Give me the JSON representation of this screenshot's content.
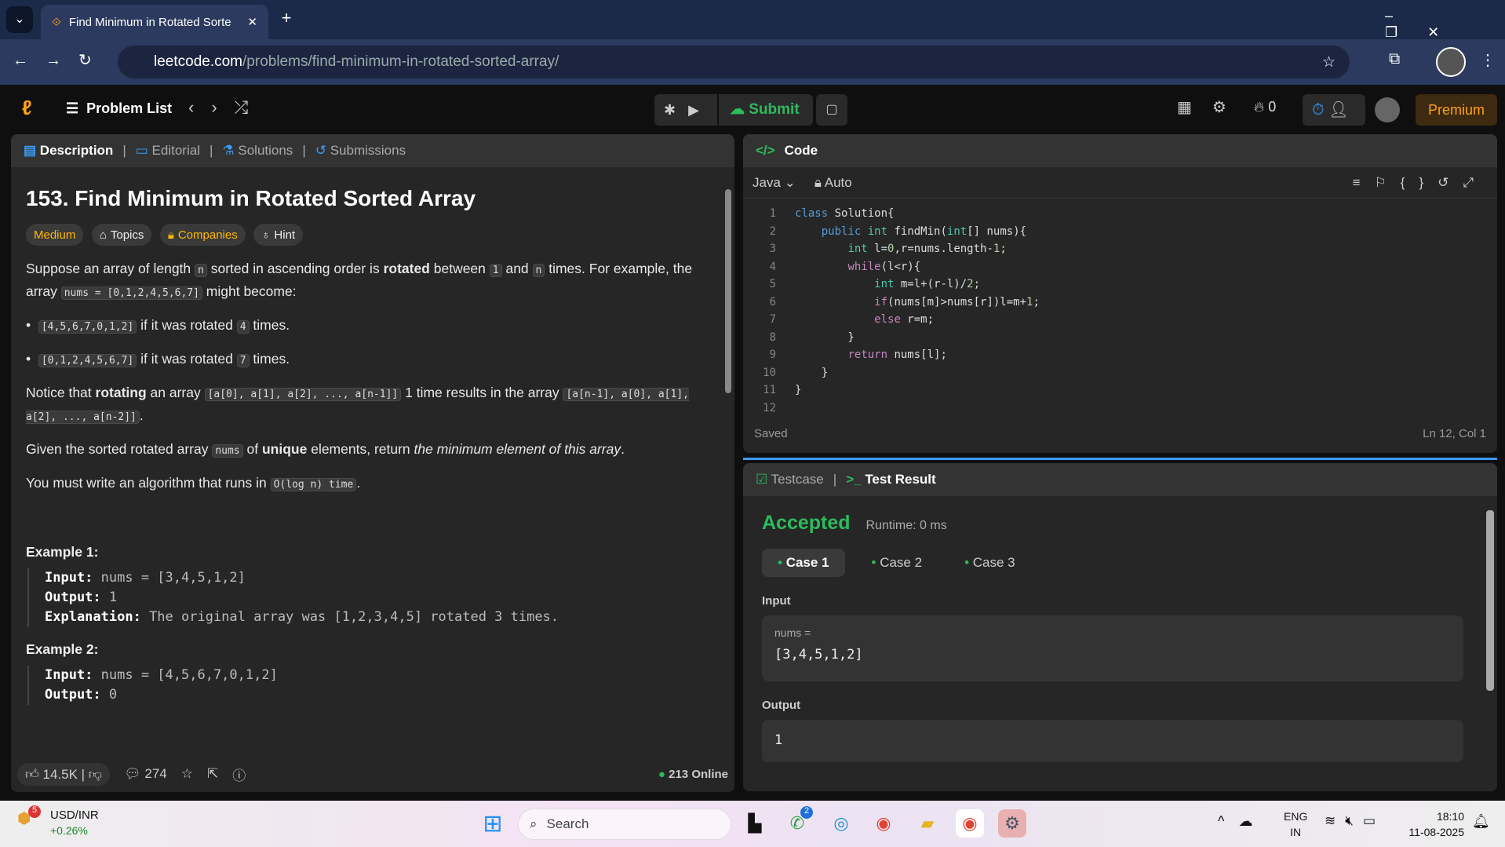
{
  "browser": {
    "tab_title": "Find Minimum in Rotated Sorte",
    "url_domain": "leetcode.com",
    "url_path": "/problems/find-minimum-in-rotated-sorted-array/"
  },
  "header": {
    "problem_list": "Problem List",
    "submit": "Submit",
    "streak": "0",
    "premium": "Premium"
  },
  "left_tabs": [
    "Description",
    "Editorial",
    "Solutions",
    "Submissions"
  ],
  "problem": {
    "title": "153. Find Minimum in Rotated Sorted Array",
    "difficulty": "Medium",
    "topics": "Topics",
    "companies": "Companies",
    "hint": "Hint",
    "p1a": "Suppose an array of length ",
    "p1n": "n",
    "p1b": " sorted in ascending order is ",
    "p1rot": "rotated",
    "p1c": " between ",
    "p1one": "1",
    "p1d": " and ",
    "p1n2": "n",
    "p1e": " times. For example, the array ",
    "p1code": "nums = [0,1,2,4,5,6,7]",
    "p1f": " might become:",
    "b1code": "[4,5,6,7,0,1,2]",
    "b1a": " if it was rotated ",
    "b1n": "4",
    "b1b": " times.",
    "b2code": "[0,1,2,4,5,6,7]",
    "b2a": " if it was rotated ",
    "b2n": "7",
    "b2b": " times.",
    "p2a": "Notice that ",
    "p2b": "rotating",
    "p2c": " an array ",
    "p2code1": "[a[0], a[1], a[2], ..., a[n-1]]",
    "p2d": " 1 time results in the array ",
    "p2code2": "[a[n-1], a[0], a[1], a[2], ..., a[n-2]]",
    "p2e": ".",
    "p3a": "Given the sorted rotated array ",
    "p3code": "nums",
    "p3b": " of ",
    "p3c": "unique",
    "p3d": " elements, return ",
    "p3e": "the minimum element of this array",
    "p3f": ".",
    "p4a": "You must write an algorithm that runs in ",
    "p4code": "O(log n) time",
    "p4b": ".",
    "ex1_title": "Example 1:",
    "ex1_in_l": "Input:",
    "ex1_in": " nums = [3,4,5,1,2]",
    "ex1_out_l": "Output:",
    "ex1_out": " 1",
    "ex1_exp_l": "Explanation:",
    "ex1_exp": " The original array was [1,2,3,4,5] rotated 3 times.",
    "ex2_title": "Example 2:",
    "ex2_in_l": "Input:",
    "ex2_in": " nums = [4,5,6,7,0,1,2]",
    "ex2_out_l": "Output:",
    "ex2_out": " 0"
  },
  "footer": {
    "likes": "14.5K",
    "comments": "274",
    "online": "213 Online"
  },
  "code": {
    "title": "Code",
    "language": "Java",
    "mode": "Auto",
    "status": "Saved",
    "cursor": "Ln 12, Col 1",
    "lines": [
      "class Solution{",
      "    public int findMin(int[] nums){",
      "        int l=0,r=nums.length-1;",
      "        while(l<r){",
      "            int m=l+(r-l)/2;",
      "            if(nums[m]>nums[r])l=m+1;",
      "            else r=m;",
      "        }",
      "        return nums[l];",
      "    }",
      "}",
      ""
    ]
  },
  "result": {
    "tab_testcase": "Testcase",
    "tab_result": "Test Result",
    "verdict": "Accepted",
    "runtime": "Runtime: 0 ms",
    "cases": [
      "Case 1",
      "Case 2",
      "Case 3"
    ],
    "input_label": "Input",
    "var": "nums =",
    "input": "[3,4,5,1,2]",
    "output_label": "Output",
    "output": "1"
  },
  "taskbar": {
    "ticker": "USD/INR",
    "change": "+0.26%",
    "badge": "5",
    "search": "Search",
    "whatsapp_badge": "2",
    "lang1": "ENG",
    "lang2": "IN",
    "time": "18:10",
    "date": "11-08-2025"
  },
  "colors": {
    "accepted": "#2cbb5d",
    "medium": "#ffb800",
    "premium": "#ffa116"
  }
}
